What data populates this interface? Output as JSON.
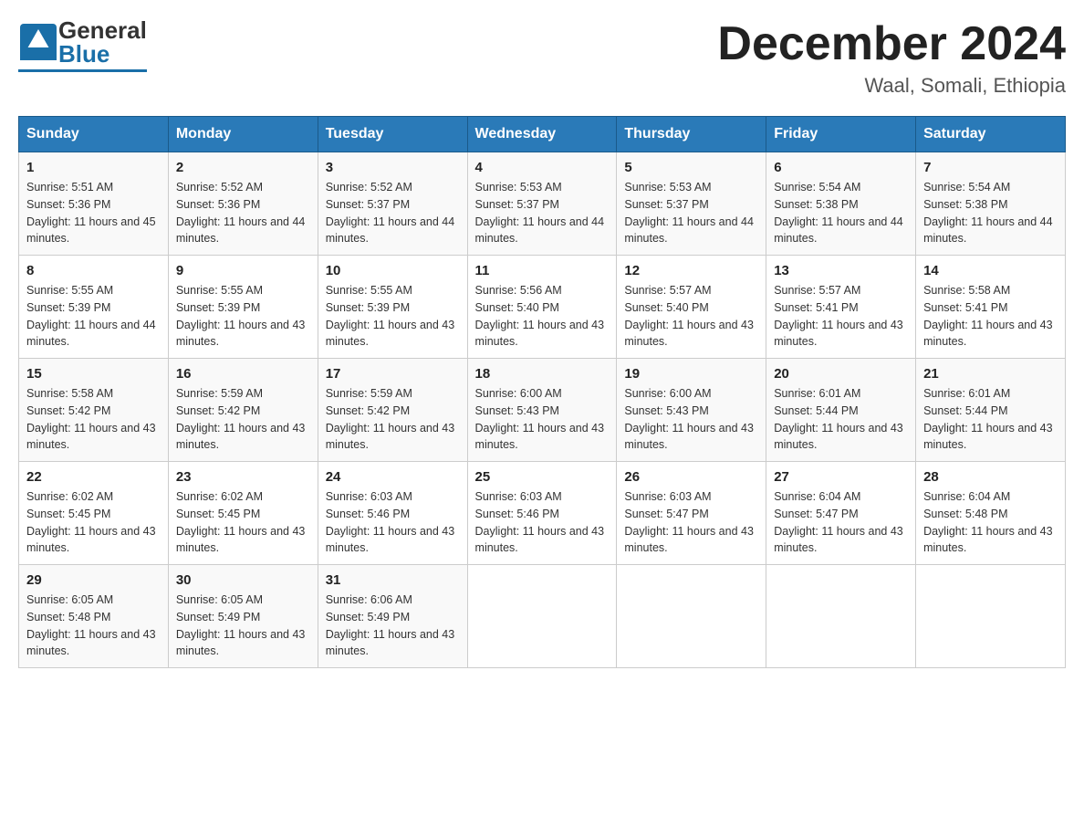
{
  "header": {
    "logo_general": "General",
    "logo_blue": "Blue",
    "month_title": "December 2024",
    "location": "Waal, Somali, Ethiopia"
  },
  "days_of_week": [
    "Sunday",
    "Monday",
    "Tuesday",
    "Wednesday",
    "Thursday",
    "Friday",
    "Saturday"
  ],
  "weeks": [
    [
      {
        "day": "1",
        "sunrise": "5:51 AM",
        "sunset": "5:36 PM",
        "daylight": "11 hours and 45 minutes."
      },
      {
        "day": "2",
        "sunrise": "5:52 AM",
        "sunset": "5:36 PM",
        "daylight": "11 hours and 44 minutes."
      },
      {
        "day": "3",
        "sunrise": "5:52 AM",
        "sunset": "5:37 PM",
        "daylight": "11 hours and 44 minutes."
      },
      {
        "day": "4",
        "sunrise": "5:53 AM",
        "sunset": "5:37 PM",
        "daylight": "11 hours and 44 minutes."
      },
      {
        "day": "5",
        "sunrise": "5:53 AM",
        "sunset": "5:37 PM",
        "daylight": "11 hours and 44 minutes."
      },
      {
        "day": "6",
        "sunrise": "5:54 AM",
        "sunset": "5:38 PM",
        "daylight": "11 hours and 44 minutes."
      },
      {
        "day": "7",
        "sunrise": "5:54 AM",
        "sunset": "5:38 PM",
        "daylight": "11 hours and 44 minutes."
      }
    ],
    [
      {
        "day": "8",
        "sunrise": "5:55 AM",
        "sunset": "5:39 PM",
        "daylight": "11 hours and 44 minutes."
      },
      {
        "day": "9",
        "sunrise": "5:55 AM",
        "sunset": "5:39 PM",
        "daylight": "11 hours and 43 minutes."
      },
      {
        "day": "10",
        "sunrise": "5:55 AM",
        "sunset": "5:39 PM",
        "daylight": "11 hours and 43 minutes."
      },
      {
        "day": "11",
        "sunrise": "5:56 AM",
        "sunset": "5:40 PM",
        "daylight": "11 hours and 43 minutes."
      },
      {
        "day": "12",
        "sunrise": "5:57 AM",
        "sunset": "5:40 PM",
        "daylight": "11 hours and 43 minutes."
      },
      {
        "day": "13",
        "sunrise": "5:57 AM",
        "sunset": "5:41 PM",
        "daylight": "11 hours and 43 minutes."
      },
      {
        "day": "14",
        "sunrise": "5:58 AM",
        "sunset": "5:41 PM",
        "daylight": "11 hours and 43 minutes."
      }
    ],
    [
      {
        "day": "15",
        "sunrise": "5:58 AM",
        "sunset": "5:42 PM",
        "daylight": "11 hours and 43 minutes."
      },
      {
        "day": "16",
        "sunrise": "5:59 AM",
        "sunset": "5:42 PM",
        "daylight": "11 hours and 43 minutes."
      },
      {
        "day": "17",
        "sunrise": "5:59 AM",
        "sunset": "5:42 PM",
        "daylight": "11 hours and 43 minutes."
      },
      {
        "day": "18",
        "sunrise": "6:00 AM",
        "sunset": "5:43 PM",
        "daylight": "11 hours and 43 minutes."
      },
      {
        "day": "19",
        "sunrise": "6:00 AM",
        "sunset": "5:43 PM",
        "daylight": "11 hours and 43 minutes."
      },
      {
        "day": "20",
        "sunrise": "6:01 AM",
        "sunset": "5:44 PM",
        "daylight": "11 hours and 43 minutes."
      },
      {
        "day": "21",
        "sunrise": "6:01 AM",
        "sunset": "5:44 PM",
        "daylight": "11 hours and 43 minutes."
      }
    ],
    [
      {
        "day": "22",
        "sunrise": "6:02 AM",
        "sunset": "5:45 PM",
        "daylight": "11 hours and 43 minutes."
      },
      {
        "day": "23",
        "sunrise": "6:02 AM",
        "sunset": "5:45 PM",
        "daylight": "11 hours and 43 minutes."
      },
      {
        "day": "24",
        "sunrise": "6:03 AM",
        "sunset": "5:46 PM",
        "daylight": "11 hours and 43 minutes."
      },
      {
        "day": "25",
        "sunrise": "6:03 AM",
        "sunset": "5:46 PM",
        "daylight": "11 hours and 43 minutes."
      },
      {
        "day": "26",
        "sunrise": "6:03 AM",
        "sunset": "5:47 PM",
        "daylight": "11 hours and 43 minutes."
      },
      {
        "day": "27",
        "sunrise": "6:04 AM",
        "sunset": "5:47 PM",
        "daylight": "11 hours and 43 minutes."
      },
      {
        "day": "28",
        "sunrise": "6:04 AM",
        "sunset": "5:48 PM",
        "daylight": "11 hours and 43 minutes."
      }
    ],
    [
      {
        "day": "29",
        "sunrise": "6:05 AM",
        "sunset": "5:48 PM",
        "daylight": "11 hours and 43 minutes."
      },
      {
        "day": "30",
        "sunrise": "6:05 AM",
        "sunset": "5:49 PM",
        "daylight": "11 hours and 43 minutes."
      },
      {
        "day": "31",
        "sunrise": "6:06 AM",
        "sunset": "5:49 PM",
        "daylight": "11 hours and 43 minutes."
      },
      null,
      null,
      null,
      null
    ]
  ],
  "labels": {
    "sunrise": "Sunrise:",
    "sunset": "Sunset:",
    "daylight": "Daylight:"
  }
}
